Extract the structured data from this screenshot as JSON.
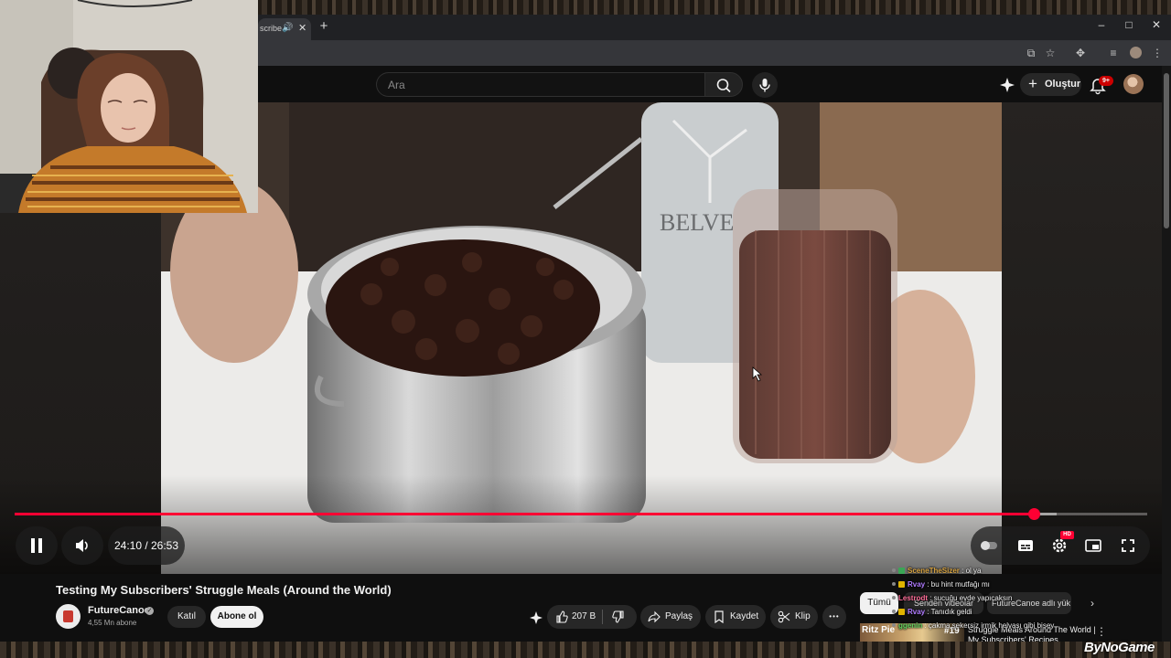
{
  "browser": {
    "tab_title": "scribe",
    "new_tab": "+",
    "window_controls": [
      "–",
      "□",
      "✕"
    ]
  },
  "header": {
    "search_placeholder": "Ara",
    "create_label": "Oluştur",
    "notification_count": "9+"
  },
  "player": {
    "current_time": "24:10",
    "duration": "26:53",
    "time_display": "24:10 / 26:53",
    "progress": 0.9,
    "buffered": 0.92,
    "hd_badge": "HD",
    "state": "playing",
    "colors": {
      "progress": "#ff0033"
    }
  },
  "video": {
    "title": "Testing My Subscribers' Struggle Meals (Around the World)",
    "channel": "FutureCanoe",
    "subscribers": "4,55 Mn abone",
    "join_label": "Katıl",
    "subscribe_label": "Abone ol",
    "likes": "207 B",
    "share_label": "Paylaş",
    "save_label": "Kaydet",
    "clip_label": "Klip",
    "more_label": "•••"
  },
  "sidebar": {
    "chips": [
      "Tümü",
      "Senden videolar",
      "FutureCanoe adlı yük"
    ],
    "recommendation": {
      "thumb_text": "Ritz Pie",
      "thumb_number": "#19",
      "title": "Struggle Meals Around The World | My Subscribers' Recipes"
    }
  },
  "chat": [
    {
      "user": "SceneTheSizer",
      "message": "ol ya",
      "color": "#d9a441",
      "badge": "#3aa655"
    },
    {
      "user": "Rvay",
      "message": "bu hint mutfağı mı",
      "color": "#b07cff",
      "badge": "#e0b400"
    },
    {
      "user": "Lestrodt",
      "message": "sucuğu evde yapıcaksın",
      "color": "#ff6f9a",
      "badge": ""
    },
    {
      "user": "Rvay",
      "message": "Tanıdık geldi",
      "color": "#b07cff",
      "badge": "#e0b400"
    },
    {
      "user": "ggenin",
      "message": "çakma şekersiz irmik helvası gibi bişey",
      "color": "#5fd35f",
      "badge": ""
    }
  ],
  "watermark": "ByNoGame"
}
